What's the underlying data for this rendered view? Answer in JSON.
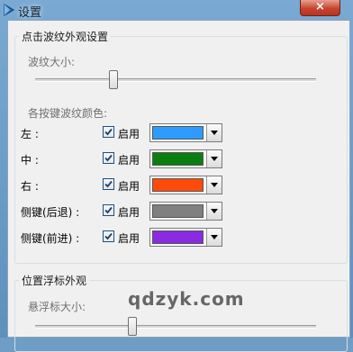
{
  "window": {
    "title": "设置",
    "close_label": "×"
  },
  "ripple_group": {
    "title": "点击波纹外观设置",
    "size_label": "波纹大小:",
    "size_level": 0.32,
    "colors_label": "各按键波纹颜色:",
    "rows": [
      {
        "label": "左 :",
        "enable_label": "启用",
        "checked": true,
        "color": "#2e9bff"
      },
      {
        "label": "中 :",
        "enable_label": "启用",
        "checked": true,
        "color": "#0a7f10"
      },
      {
        "label": "右 :",
        "enable_label": "启用",
        "checked": true,
        "color": "#ff4a0a"
      },
      {
        "label": "侧键(后退) :",
        "enable_label": "启用",
        "checked": true,
        "color": "#808080"
      },
      {
        "label": "侧键(前进) :",
        "enable_label": "启用",
        "checked": true,
        "color": "#8a2be2"
      }
    ]
  },
  "cursor_group": {
    "title": "位置浮标外观",
    "size_label": "悬浮标大小:",
    "size_level": 0.35
  },
  "watermark": "qdzyk.com"
}
